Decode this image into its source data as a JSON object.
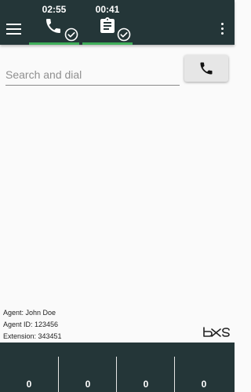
{
  "topbar": {
    "menu_icon": "hamburger-menu-icon",
    "tabs": [
      {
        "timer": "02:55",
        "icon": "phone-icon",
        "status_icon": "check-circle-icon",
        "accent": "#3fae5a"
      },
      {
        "timer": "00:41",
        "icon": "clipboard-icon",
        "status_icon": "check-circle-icon",
        "accent": "#3fae5a"
      }
    ],
    "more_icon": "more-vert-icon",
    "background": "#243638"
  },
  "dial": {
    "placeholder": "Search and dial",
    "value": "",
    "button_icon": "phone-icon"
  },
  "agent": {
    "name_line": "Agent: John Doe",
    "id_line": "Agent ID: 123456",
    "extension_line": "Extension: 343451"
  },
  "stats": {
    "values": [
      "0",
      "0",
      "0",
      "0"
    ]
  }
}
